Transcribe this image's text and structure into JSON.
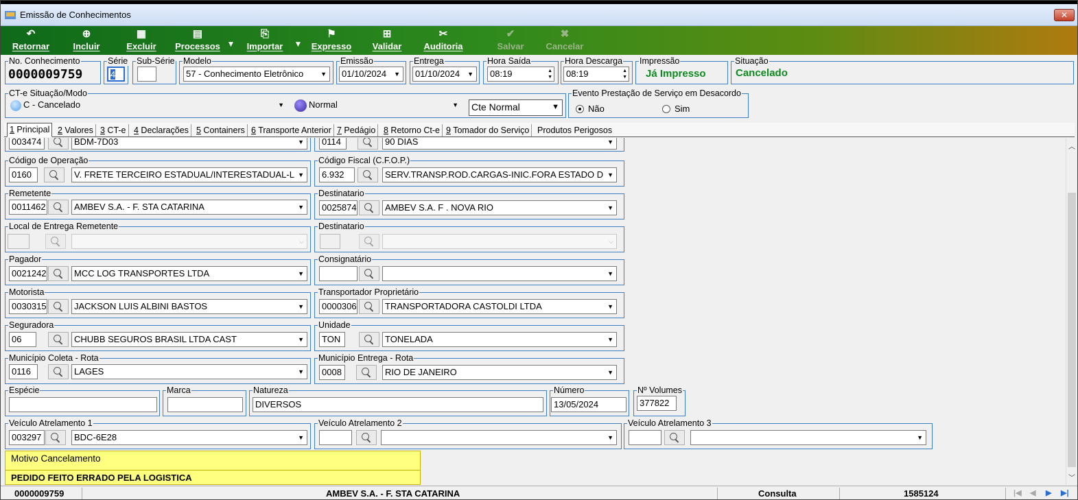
{
  "window": {
    "title": "Emissão de Conhecimentos",
    "close_label": "✕"
  },
  "toolbar": {
    "retornar": "Retornar",
    "incluir": "Incluir",
    "excluir": "Excluir",
    "processos": "Processos",
    "importar": "Importar",
    "expresso": "Expresso",
    "validar": "Validar",
    "auditoria": "Auditoria",
    "salvar": "Salvar",
    "cancelar": "Cancelar"
  },
  "header": {
    "no_conhecimento": {
      "label": "No. Conhecimento",
      "value": "0000009759"
    },
    "serie": {
      "label": "Série",
      "value": "4"
    },
    "sub_serie": {
      "label": "Sub-Série",
      "value": ""
    },
    "modelo": {
      "label": "Modelo",
      "value": "57 - Conhecimento Eletrônico"
    },
    "emissao": {
      "label": "Emissão",
      "value": "01/10/2024"
    },
    "entrega": {
      "label": "Entrega",
      "value": "01/10/2024"
    },
    "hora_saida": {
      "label": "Hora Saída",
      "value": "08:19"
    },
    "hora_descarga": {
      "label": "Hora Descarga",
      "value": "08:19"
    },
    "impressao": {
      "label": "Impressão",
      "value": "Já Impresso"
    },
    "situacao": {
      "label": "Situação",
      "value": "Cancelado"
    }
  },
  "cte": {
    "label": "CT-e Situação/Modo",
    "situacao": "C - Cancelado",
    "modo": "Normal",
    "tipo": "Cte Normal"
  },
  "evento": {
    "label": "Evento Prestação de Serviço em Desacordo",
    "nao": "Não",
    "sim": "Sim",
    "selected": "Não"
  },
  "tabs": [
    {
      "key": "1",
      "label": " Principal"
    },
    {
      "key": "2",
      "label": " Valores"
    },
    {
      "key": "3",
      "label": " CT-e"
    },
    {
      "key": "4",
      "label": " Declarações"
    },
    {
      "key": "5",
      "label": " Containers"
    },
    {
      "key": "6",
      "label": " Transporte Anterior"
    },
    {
      "key": "7",
      "label": " Pedágio"
    },
    {
      "key": "8",
      "label": " Retorno Ct-e"
    },
    {
      "key": "9",
      "label": " Tomador do Serviço"
    },
    {
      "key": "",
      "label": "Produtos Perigosos"
    }
  ],
  "form": {
    "top_partial_left": {
      "code": "003474",
      "value": "BDM-7D03"
    },
    "top_partial_right": {
      "code": "0114",
      "value": "90 DIAS"
    },
    "codigo_operacao": {
      "label": "Código de Operação",
      "code": "0160",
      "value": "V. FRETE TERCEIRO ESTADUAL/INTERESTADUAL-LR"
    },
    "codigo_fiscal": {
      "label": "Código Fiscal (C.F.O.P.)",
      "code": "6.932",
      "value": "SERV.TRANSP.ROD.CARGAS-INIC.FORA ESTADO DE"
    },
    "remetente": {
      "label": "Remetente",
      "code": "0011462",
      "value": "AMBEV S.A. - F. STA CATARINA"
    },
    "destinatario": {
      "label": "Destinatario",
      "code": "0025874",
      "value": "AMBEV S.A. F . NOVA RIO"
    },
    "local_entrega_remetente": {
      "label": "Local de Entrega Remetente",
      "code": "",
      "value": ""
    },
    "destinatario2": {
      "label": "Destinatario",
      "code": "",
      "value": ""
    },
    "pagador": {
      "label": "Pagador",
      "code": "0021242",
      "value": "MCC LOG TRANSPORTES LTDA"
    },
    "consignatario": {
      "label": "Consignatário",
      "code": "",
      "value": ""
    },
    "motorista": {
      "label": "Motorista",
      "code": "0030315",
      "value": "JACKSON LUIS ALBINI BASTOS"
    },
    "transportador": {
      "label": "Transportador Proprietário",
      "code": "0000306",
      "value": "TRANSPORTADORA CASTOLDI LTDA"
    },
    "seguradora": {
      "label": "Seguradora",
      "code": "06",
      "value": "CHUBB SEGUROS BRASIL LTDA CAST"
    },
    "unidade": {
      "label": "Unidade",
      "code": "TON",
      "value": "TONELADA"
    },
    "municipio_coleta": {
      "label": "Município Coleta - Rota",
      "code": "0116",
      "value": "LAGES"
    },
    "municipio_entrega": {
      "label": "Município Entrega - Rota",
      "code": "0008",
      "value": "RIO DE JANEIRO"
    },
    "especie": {
      "label": "Espécie",
      "value": ""
    },
    "marca": {
      "label": "Marca",
      "value": ""
    },
    "natureza": {
      "label": "Natureza",
      "value": "DIVERSOS"
    },
    "numero": {
      "label": "Número",
      "value": "13/05/2024"
    },
    "volumes": {
      "label": "Nº Volumes",
      "value": "377822"
    },
    "veiculo1": {
      "label": "Veículo Atrelamento 1",
      "code": "003297",
      "value": "BDC-6E28"
    },
    "veiculo2": {
      "label": "Veículo Atrelamento 2",
      "code": "",
      "value": ""
    },
    "veiculo3": {
      "label": "Veículo Atrelamento 3",
      "code": "",
      "value": ""
    },
    "motivo": {
      "label": "Motivo Cancelamento",
      "value": "PEDIDO FEITO ERRADO PELA LOGISTICA"
    }
  },
  "statusbar": {
    "numero": "0000009759",
    "cliente": "AMBEV S.A. - F. STA CATARINA",
    "modo": "Consulta",
    "registro": "1585124"
  }
}
